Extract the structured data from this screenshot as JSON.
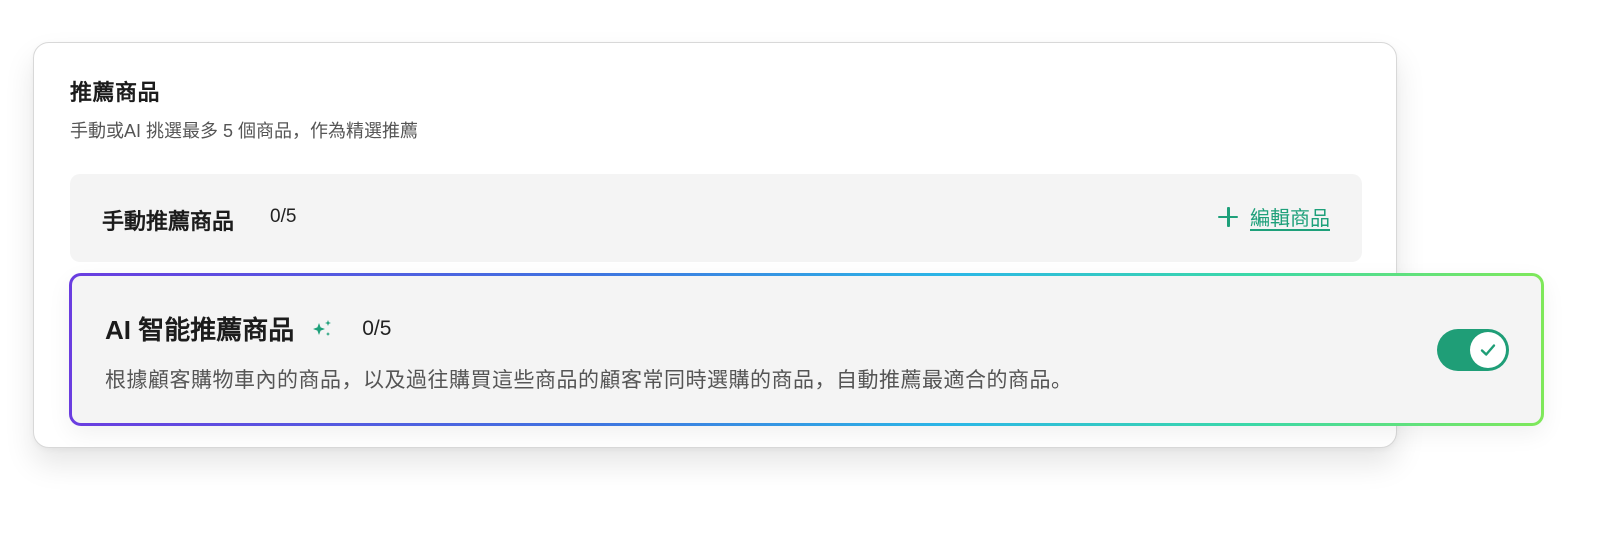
{
  "section": {
    "title": "推薦商品",
    "subtitle": "手動或AI 挑選最多 5 個商品，作為精選推薦"
  },
  "manual": {
    "title": "手動推薦商品",
    "count": "0/5",
    "edit_label": "編輯商品",
    "edit_icon": "plus-icon"
  },
  "ai": {
    "title": "AI 智能推薦商品",
    "title_icon": "sparkle-icon",
    "count": "0/5",
    "description": "根據顧客購物車內的商品，以及過往購買這些商品的顧客常同時選購的商品，自動推薦最適合的商品。",
    "toggle_on": true,
    "toggle_icon": "check-icon"
  },
  "colors": {
    "accent_green": "#1ea07a",
    "toggle_green": "#1f9e77",
    "gradient": [
      "#6a3de0",
      "#3f73e0",
      "#2bb7e6",
      "#3bd8a8",
      "#7fe85a"
    ]
  }
}
